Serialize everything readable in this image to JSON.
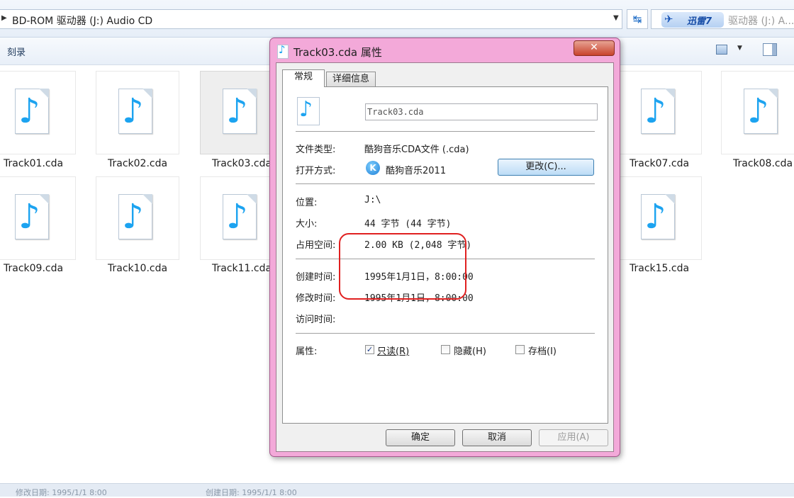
{
  "explorer": {
    "address": "BD-ROM 驱动器 (J:) Audio CD",
    "search_placeholder": "驱动器 (J:) A...",
    "thunder_label": "迅雷7",
    "toolbar_burn": "刻录",
    "files": [
      {
        "name": "Track01.cda"
      },
      {
        "name": "Track02.cda"
      },
      {
        "name": "Track03.cda",
        "selected": true
      },
      {
        "name": "Track07.cda"
      },
      {
        "name": "Track08.cda"
      },
      {
        "name": "Track09.cda"
      },
      {
        "name": "Track10.cda"
      },
      {
        "name": "Track11.cda"
      },
      {
        "name": "Track15.cda"
      }
    ],
    "status_modified": "修改日期: 1995/1/1 8:00",
    "status_created": "创建日期: 1995/1/1 8:00"
  },
  "dialog": {
    "title": "Track03.cda 属性",
    "close_glyph": "✕",
    "tabs": [
      "常规",
      "详细信息"
    ],
    "file_name": "Track03.cda",
    "type_label": "文件类型:",
    "type_value": "酷狗音乐CDA文件 (.cda)",
    "opens_with_label": "打开方式:",
    "opens_with_value": "酷狗音乐2011",
    "change_button": "更改(C)...",
    "location_label": "位置:",
    "location_value": "J:\\",
    "size_label": "大小:",
    "size_value": "44 字节 (44 字节)",
    "disk_size_label": "占用空间:",
    "disk_size_value": "2.00 KB (2,048 字节)",
    "created_label": "创建时间:",
    "created_value": "1995年1月1日，8:00:00",
    "modified_label": "修改时间:",
    "modified_value": "1995年1月1日，8:00:00",
    "accessed_label": "访问时间:",
    "attributes_label": "属性:",
    "attr_readonly": "只读(R)",
    "attr_readonly_checked": true,
    "attr_hidden": "隐藏(H)",
    "attr_hidden_checked": false,
    "attr_archive": "存档(I)",
    "attr_archive_checked": false,
    "ok_button": "确定",
    "cancel_button": "取消",
    "apply_button": "应用(A)"
  }
}
